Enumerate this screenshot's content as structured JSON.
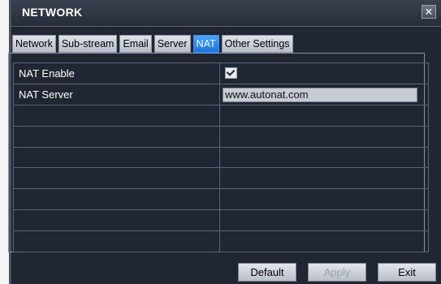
{
  "window": {
    "title": "NETWORK",
    "close_symbol": "✕"
  },
  "tabs": [
    {
      "label": "Network",
      "active": false
    },
    {
      "label": "Sub-stream",
      "active": false
    },
    {
      "label": "Email",
      "active": false
    },
    {
      "label": "Server",
      "active": false
    },
    {
      "label": "NAT",
      "active": true
    },
    {
      "label": "Other Settings",
      "active": false
    }
  ],
  "nat": {
    "enable_label": "NAT Enable",
    "enable_checked": true,
    "server_label": "NAT Server",
    "server_value": "www.autonat.com"
  },
  "buttons": {
    "default": "Default",
    "apply": "Apply",
    "exit": "Exit"
  },
  "colors": {
    "active_tab": "#2e8cf2",
    "background": "#202733"
  }
}
